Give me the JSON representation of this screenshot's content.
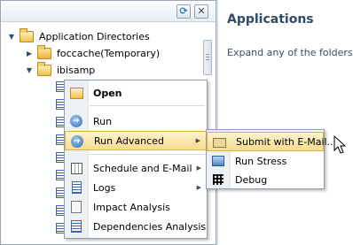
{
  "tree": {
    "root_label": "Application Directories",
    "children": [
      {
        "label": "foccache(Temporary)"
      },
      {
        "label": "ibisamp"
      }
    ]
  },
  "toolbar": {
    "refresh_icon": "refresh-icon",
    "close_icon": "close-icon",
    "refresh_glyph": "⟳",
    "close_glyph": "✕"
  },
  "right_panel": {
    "title": "Applications",
    "description": "Expand any of the folders in"
  },
  "context_menu": {
    "items": [
      {
        "label": "Open",
        "icon": "open-icon"
      },
      {
        "label": "Run",
        "icon": "run-icon"
      },
      {
        "label": "Run Advanced",
        "icon": "run-advanced-icon",
        "submenu": true
      },
      {
        "label": "Schedule and E-Mail",
        "icon": "schedule-icon",
        "submenu": true
      },
      {
        "label": "Logs",
        "icon": "logs-icon",
        "submenu": true
      },
      {
        "label": "Impact Analysis",
        "icon": "impact-icon"
      },
      {
        "label": "Dependencies Analysis",
        "icon": "dependencies-icon"
      }
    ],
    "run_glyph": "➔",
    "submenu_glyph": "▶"
  },
  "submenu": {
    "items": [
      {
        "label": "Submit with E-Mail...",
        "icon": "submit-email-icon"
      },
      {
        "label": "Run Stress",
        "icon": "run-stress-icon"
      },
      {
        "label": "Debug",
        "icon": "debug-icon"
      }
    ]
  },
  "colors": {
    "highlight": "#f6dc8b",
    "title": "#2f4a66",
    "border": "#8e9cab"
  }
}
